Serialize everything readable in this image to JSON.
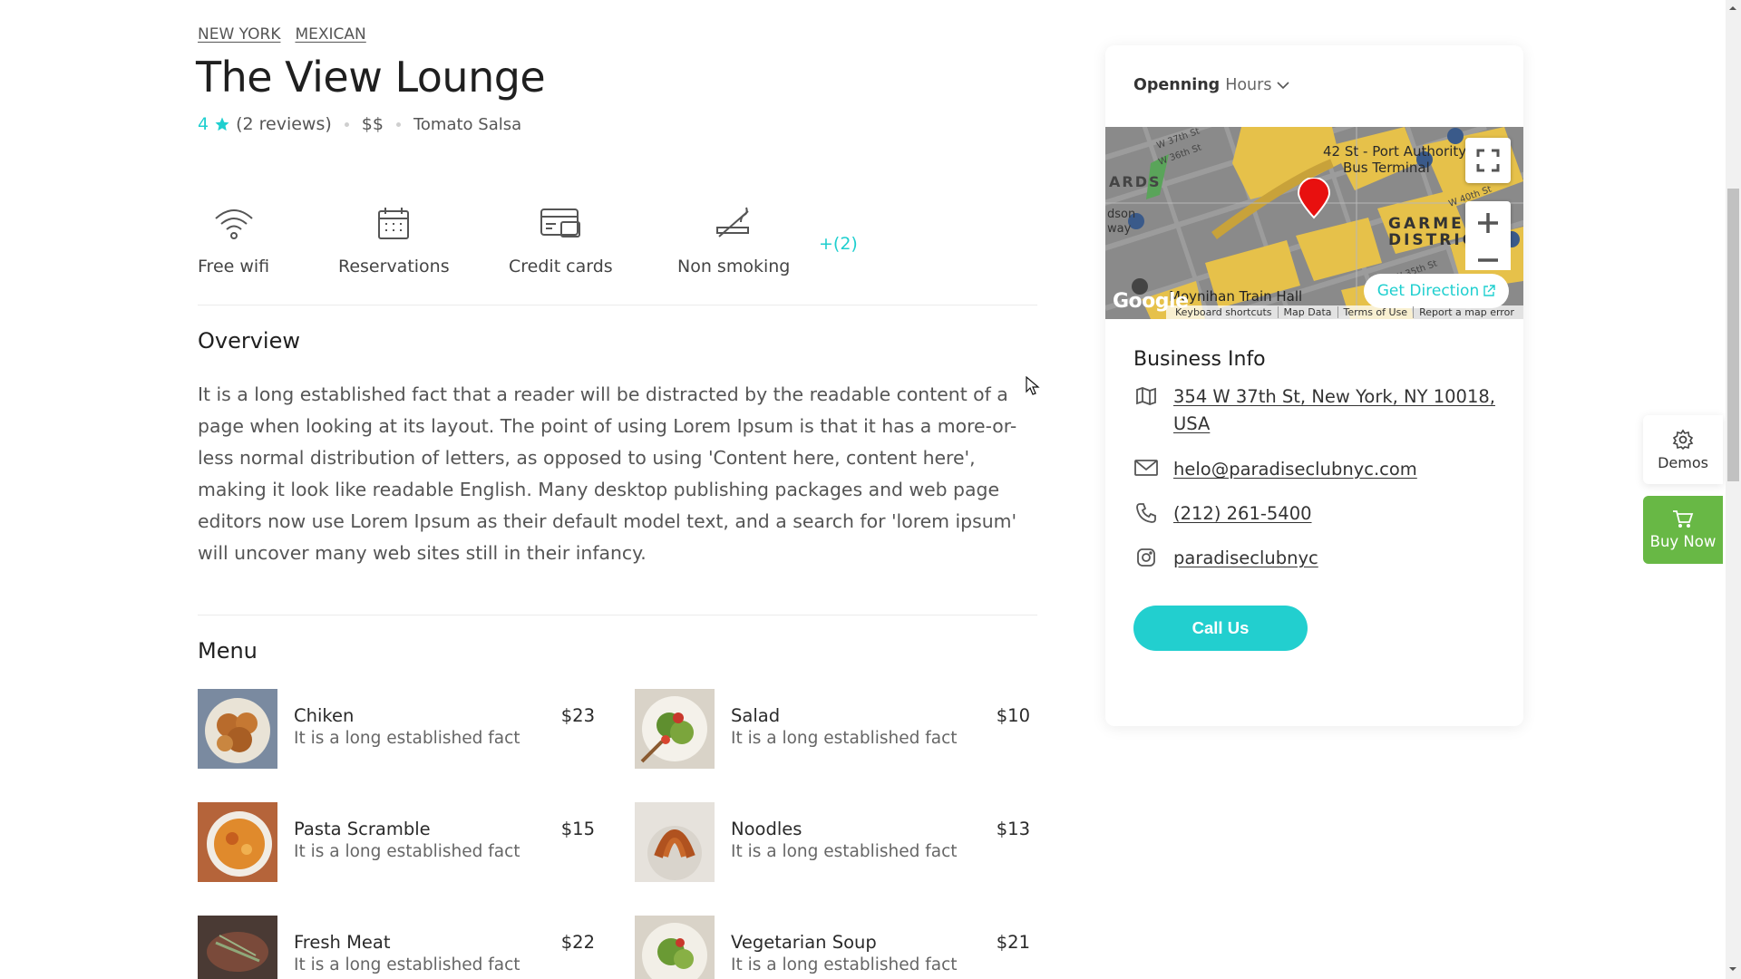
{
  "tags": [
    "NEW YORK",
    "MEXICAN"
  ],
  "title": "The View Lounge",
  "rating": {
    "score": "4",
    "reviews": "(2 reviews)",
    "price": "$$",
    "tagline": "Tomato Salsa"
  },
  "amenities": [
    {
      "icon": "wifi-icon",
      "label": "Free wifi"
    },
    {
      "icon": "calendar-icon",
      "label": "Reservations"
    },
    {
      "icon": "credit-card-icon",
      "label": "Credit cards"
    },
    {
      "icon": "no-smoking-icon",
      "label": "Non smoking"
    }
  ],
  "amenities_more": "+(2)",
  "overview": {
    "heading": "Overview",
    "text": "It is a long established fact that a reader will be distracted by the readable content of a page when looking at its layout. The point of using Lorem Ipsum is that it has a more-or-less normal distribution of letters, as opposed to using 'Content here, content here', making it look like readable English. Many desktop publishing packages and web page editors now use Lorem Ipsum as their default model text, and a search for 'lorem ipsum' will uncover many web sites still in their infancy."
  },
  "menu": {
    "heading": "Menu",
    "items": [
      {
        "name": "Chiken",
        "desc": "It is a long established fact",
        "price": "$23"
      },
      {
        "name": "Salad",
        "desc": "It is a long established fact",
        "price": "$10"
      },
      {
        "name": "Pasta Scramble",
        "desc": "It is a long established fact",
        "price": "$15"
      },
      {
        "name": "Noodles",
        "desc": "It is a long established fact",
        "price": "$13"
      },
      {
        "name": "Fresh Meat",
        "desc": "It is a long established fact",
        "price": "$22"
      },
      {
        "name": "Vegetarian Soup",
        "desc": "It is a long established fact",
        "price": "$21"
      }
    ]
  },
  "sidebar": {
    "hours_label_bold": "Openning",
    "hours_label": "Hours",
    "map": {
      "get_direction": "Get Direction",
      "google": "Google",
      "footer": [
        "Keyboard shortcuts",
        "Map Data",
        "Terms of Use",
        "Report a map error"
      ],
      "labels": {
        "port_authority": "42 St - Port Authority",
        "bus_terminal": "Bus Terminal",
        "garment": "GARMENT",
        "district": "DISTRICT",
        "moynihan": "Moynihan Train Hall",
        "yards": "ARDS",
        "hudson_1": "dson",
        "hudson_2": "way",
        "w37": "W 37th St",
        "w36": "W 36th St",
        "w40": "W 40th St",
        "w35": "W 35th St"
      }
    },
    "business_info": {
      "heading": "Business Info",
      "address_line1": "354 W 37th St, New York, NY 10018,",
      "address_line2": "USA",
      "email": "helo@paradiseclubnyc.com",
      "phone": "(212) 261-5400",
      "instagram": "paradiseclubnyc"
    },
    "call_us": "Call Us"
  },
  "floating": {
    "demos": "Demos",
    "buy_now": "Buy Now"
  },
  "colors": {
    "accent": "#22cfcf",
    "buy_now": "#68b845",
    "text": "#222222",
    "muted": "#555555"
  }
}
